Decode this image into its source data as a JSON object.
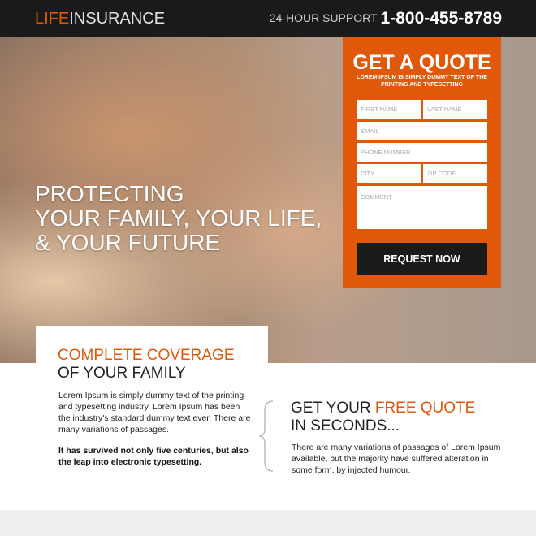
{
  "header": {
    "logo_accent": "LIFE",
    "logo_rest": "INSURANCE",
    "support_label": "24-HOUR SUPPORT",
    "phone": "1-800-455-8789"
  },
  "hero": {
    "line1": "PROTECTING",
    "line2": "YOUR FAMILY, YOUR LIFE,",
    "line3": "& YOUR FUTURE"
  },
  "form": {
    "title": "GET A QUOTE",
    "subtitle": "LOREM IPSUM IS SIMPLY DUMMY TEXT OF THE PRINTING AND TYPESETTING",
    "first_name": "FIRST NAME",
    "last_name": "LAST NAME",
    "email": "EMAIL",
    "phone": "PHONE NUMBER",
    "city": "CITY",
    "zip": "ZIP CODE",
    "comment": "COMMENT",
    "submit": "REQUEST NOW"
  },
  "coverage": {
    "title_accent": "COMPLETE COVERAGE",
    "title_rest": "OF YOUR FAMILY",
    "body": "Lorem Ipsum is simply dummy text of the printing and typesetting industry. Lorem Ipsum has been the industry's standard dummy text ever. There are many variations of passages.",
    "bold": "It has survived not only five centuries, but also the leap into electronic typesetting."
  },
  "quote": {
    "title_pre": "GET YOUR ",
    "title_accent": "FREE QUOTE",
    "title_line2": "IN SECONDS...",
    "body": "There are many variations of passages of Lorem Ipsum available, but the majority have suffered alteration in some form, by injected humour."
  },
  "colors": {
    "accent": "#e0580a",
    "dark": "#1a1a1a"
  }
}
